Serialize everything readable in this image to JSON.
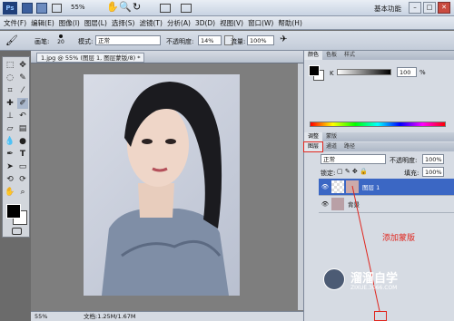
{
  "topbar": {
    "zoom": "55%",
    "workspace": "基本功能"
  },
  "menu": [
    "文件(F)",
    "编辑(E)",
    "图像(I)",
    "图层(L)",
    "选择(S)",
    "滤镜(T)",
    "分析(A)",
    "3D(D)",
    "视图(V)",
    "窗口(W)",
    "帮助(H)"
  ],
  "options": {
    "brush_label": "画笔:",
    "brush_size": "20",
    "mode_label": "模式:",
    "mode_value": "正常",
    "opacity_label": "不透明度:",
    "opacity_value": "14%",
    "flow_label": "流量:",
    "flow_value": "100%"
  },
  "document": {
    "tab_title": "1.jpg @ 55% (图层 1, 图层蒙版/8) *",
    "status_zoom": "55%",
    "status_doc": "文档:1.25M/1.67M"
  },
  "color_panel": {
    "tabs": [
      "颜色",
      "色板",
      "样式"
    ],
    "k_label": "K",
    "k_value": "100",
    "k_unit": "%"
  },
  "adj_panel": {
    "tabs": [
      "调整",
      "蒙版"
    ]
  },
  "layers_panel": {
    "tabs": [
      "图层",
      "通道",
      "路径"
    ],
    "blend_mode": "正常",
    "opacity_label": "不透明度:",
    "opacity_value": "100%",
    "lock_label": "锁定:",
    "fill_label": "填充:",
    "fill_value": "100%",
    "layers": [
      {
        "name": "图层 1",
        "selected": true
      },
      {
        "name": "背景",
        "selected": false
      }
    ]
  },
  "annotation": {
    "text": "添加蒙版"
  },
  "watermark": {
    "name": "溜溜自学",
    "url": "ZIXUE.3066.COM"
  }
}
